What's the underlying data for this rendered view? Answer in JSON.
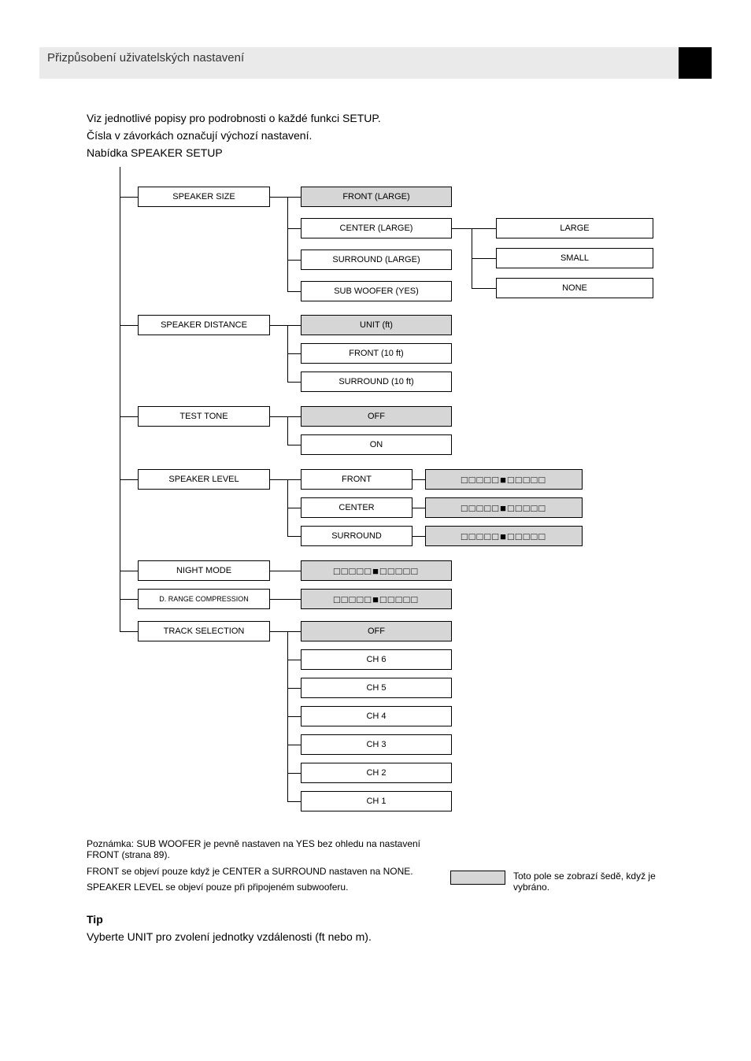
{
  "header": "Přizpůsobení uživatelských nastavení",
  "intro": {
    "l1": "Viz jednotlivé popisy pro podrobnosti o každé funkci SETUP.",
    "l2": "Čísla v závorkách označují výchozí nastavení.",
    "l3": "Nabídka SPEAKER SETUP"
  },
  "menu": {
    "speaker_size": {
      "label": "SPEAKER SIZE",
      "children": [
        {
          "label": "FRONT (LARGE)",
          "gray": true
        },
        {
          "label": "CENTER (LARGE)"
        },
        {
          "label": "SURROUND (LARGE)"
        },
        {
          "label": "SUB WOOFER (YES)"
        }
      ],
      "branch": [
        {
          "label": "LARGE"
        },
        {
          "label": "SMALL"
        },
        {
          "label": "NONE"
        }
      ]
    },
    "speaker_distance": {
      "label": "SPEAKER DISTANCE",
      "children": [
        {
          "label": "UNIT (ft)",
          "gray": true
        },
        {
          "label": "FRONT (10 ft)"
        },
        {
          "label": "SURROUND (10 ft)"
        }
      ]
    },
    "test_tone": {
      "label": "TEST TONE",
      "children": [
        {
          "label": "OFF",
          "gray": true
        },
        {
          "label": "ON"
        }
      ]
    },
    "speaker_level": {
      "label": "SPEAKER LEVEL",
      "children": [
        {
          "label": "FRONT"
        },
        {
          "label": "CENTER"
        },
        {
          "label": "SURROUND"
        }
      ]
    },
    "night_mode": {
      "label": "NIGHT MODE"
    },
    "drc": {
      "label": "D. RANGE COMPRESSION"
    },
    "track_selection": {
      "label": "TRACK SELECTION",
      "children": [
        {
          "label": "OFF",
          "gray": true
        },
        {
          "label": "CH 6"
        },
        {
          "label": "CH 5"
        },
        {
          "label": "CH 4"
        },
        {
          "label": "CH 3"
        },
        {
          "label": "CH 2"
        },
        {
          "label": "CH 1"
        }
      ]
    }
  },
  "slider_glyph": "□□□□□■□□□□□",
  "legend": "Toto pole se zobrazí šedě, když je vybráno.",
  "footnotes": {
    "f1": "Poznámka: SUB WOOFER je pevně nastaven na YES bez ohledu na nastavení FRONT (strana 89).",
    "f2": "FRONT se objeví pouze když je CENTER a SURROUND nastaven na NONE.",
    "f3": "SPEAKER LEVEL se objeví pouze při připojeném subwooferu."
  },
  "tip": {
    "title": "Tip",
    "body": "Vyberte UNIT pro zvolení jednotky vzdálenosti (ft nebo m)."
  }
}
